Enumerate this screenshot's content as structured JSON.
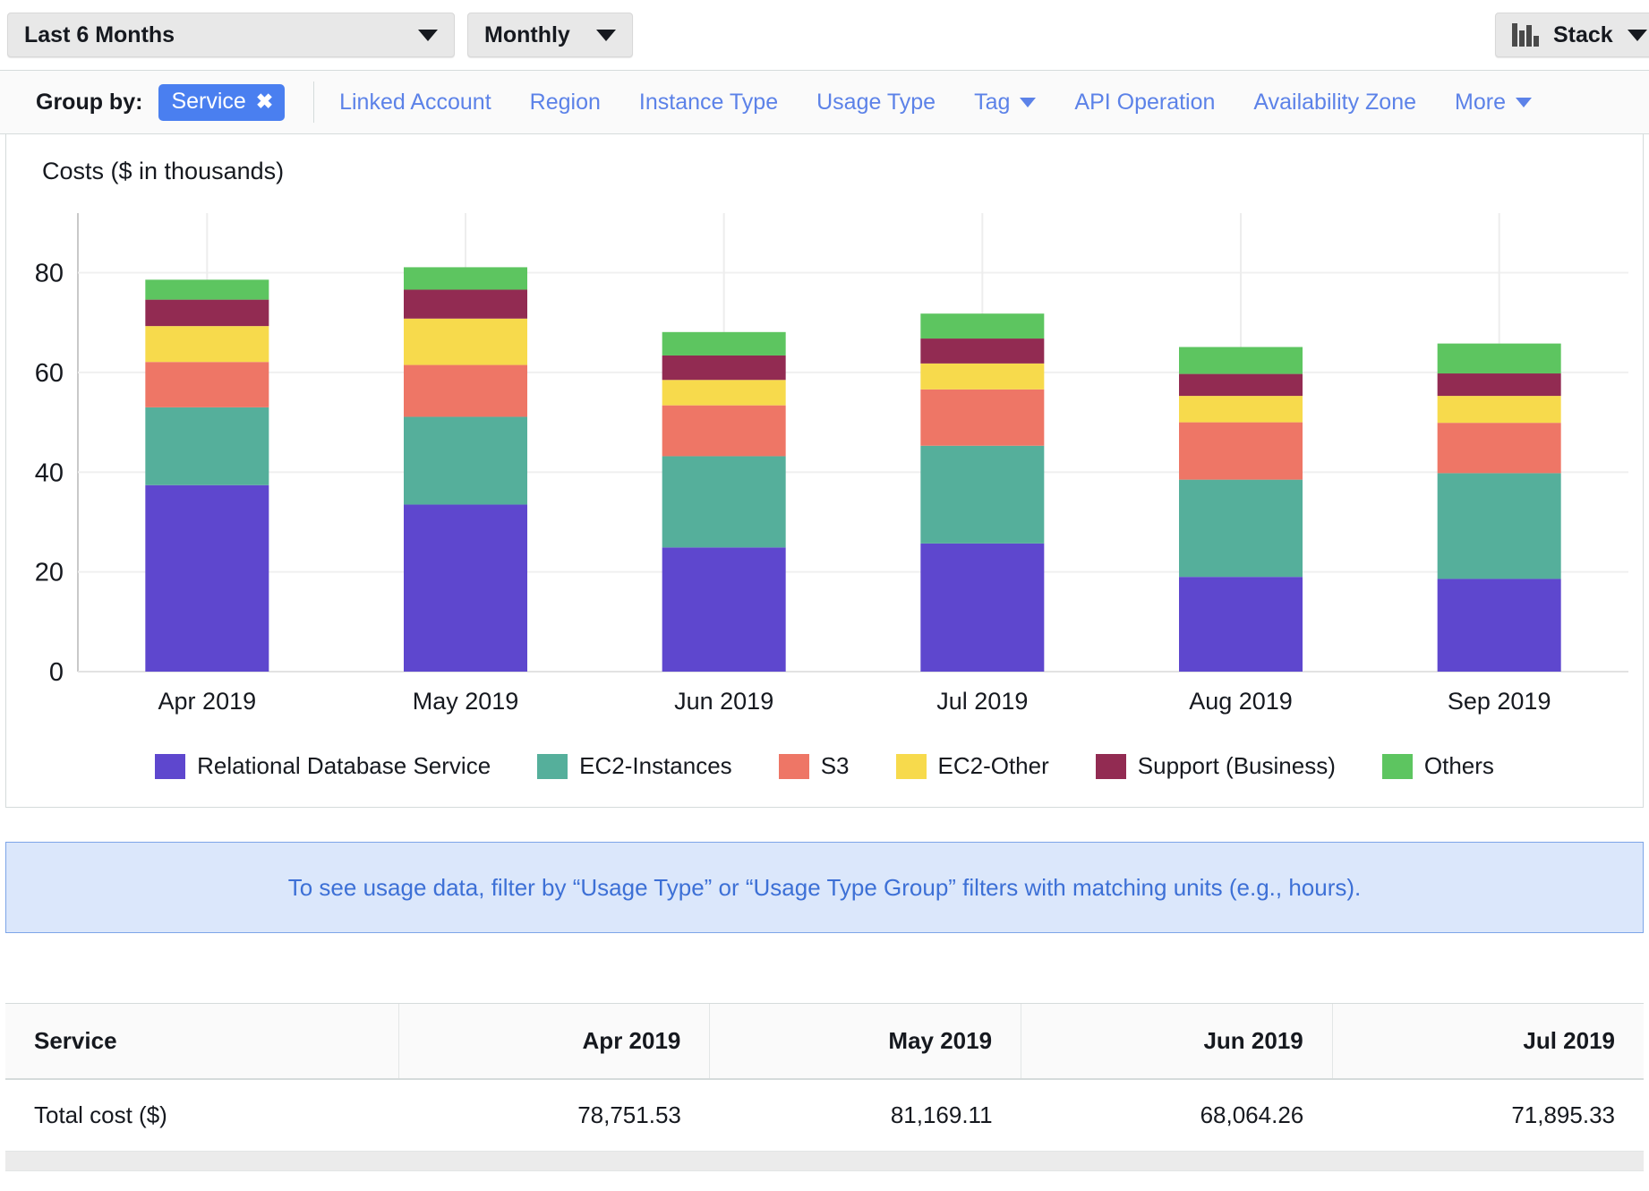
{
  "toolbar": {
    "date_range": "Last 6 Months",
    "granularity": "Monthly",
    "chart_style": "Stack",
    "chart_style_icon": "bar-chart-icon"
  },
  "group_by": {
    "label": "Group by:",
    "active_chip": "Service",
    "chip_remove_icon": "✖",
    "options": [
      {
        "label": "Linked Account",
        "has_caret": false
      },
      {
        "label": "Region",
        "has_caret": false
      },
      {
        "label": "Instance Type",
        "has_caret": false
      },
      {
        "label": "Usage Type",
        "has_caret": false
      },
      {
        "label": "Tag",
        "has_caret": true
      },
      {
        "label": "API Operation",
        "has_caret": false
      },
      {
        "label": "Availability Zone",
        "has_caret": false
      },
      {
        "label": "More",
        "has_caret": true
      }
    ]
  },
  "banner": {
    "text": "To see usage data, filter by “Usage Type” or “Usage Type Group” filters with matching units (e.g., hours)."
  },
  "table": {
    "columns": [
      "Service",
      "Apr 2019",
      "May 2019",
      "Jun 2019",
      "Jul 2019"
    ],
    "rows": [
      [
        "Total cost ($)",
        "78,751.53",
        "81,169.11",
        "68,064.26",
        "71,895.33"
      ]
    ]
  },
  "chart_data": {
    "type": "bar",
    "stacked": true,
    "title": "Costs ($ in thousands)",
    "xlabel": "",
    "ylabel": "",
    "ylim": [
      0,
      88
    ],
    "yticks": [
      0,
      20,
      40,
      60,
      80
    ],
    "grid": true,
    "legend_position": "bottom",
    "categories": [
      "Apr 2019",
      "May 2019",
      "Jun 2019",
      "Jul 2019",
      "Aug 2019",
      "Sep 2019"
    ],
    "series": [
      {
        "name": "Relational Database Service",
        "color": "#5e47ce",
        "values": [
          37.4,
          33.5,
          24.9,
          25.7,
          19.0,
          18.6
        ]
      },
      {
        "name": "EC2-Instances",
        "color": "#55af9b",
        "values": [
          15.6,
          17.6,
          18.3,
          19.6,
          19.5,
          21.2
        ]
      },
      {
        "name": "S3",
        "color": "#ee7666",
        "values": [
          9.1,
          10.4,
          10.2,
          11.3,
          11.5,
          10.1
        ]
      },
      {
        "name": "EC2-Other",
        "color": "#f7da4c",
        "values": [
          7.2,
          9.3,
          5.1,
          5.2,
          5.3,
          5.4
        ]
      },
      {
        "name": "Support (Business)",
        "color": "#922b52",
        "values": [
          5.3,
          5.8,
          4.9,
          5.0,
          4.4,
          4.5
        ]
      },
      {
        "name": "Others",
        "color": "#5dc560",
        "values": [
          4.0,
          4.5,
          4.7,
          5.0,
          5.4,
          6.0
        ]
      }
    ],
    "totals": [
      78.6,
      81.1,
      68.1,
      71.8,
      65.1,
      65.8
    ]
  }
}
